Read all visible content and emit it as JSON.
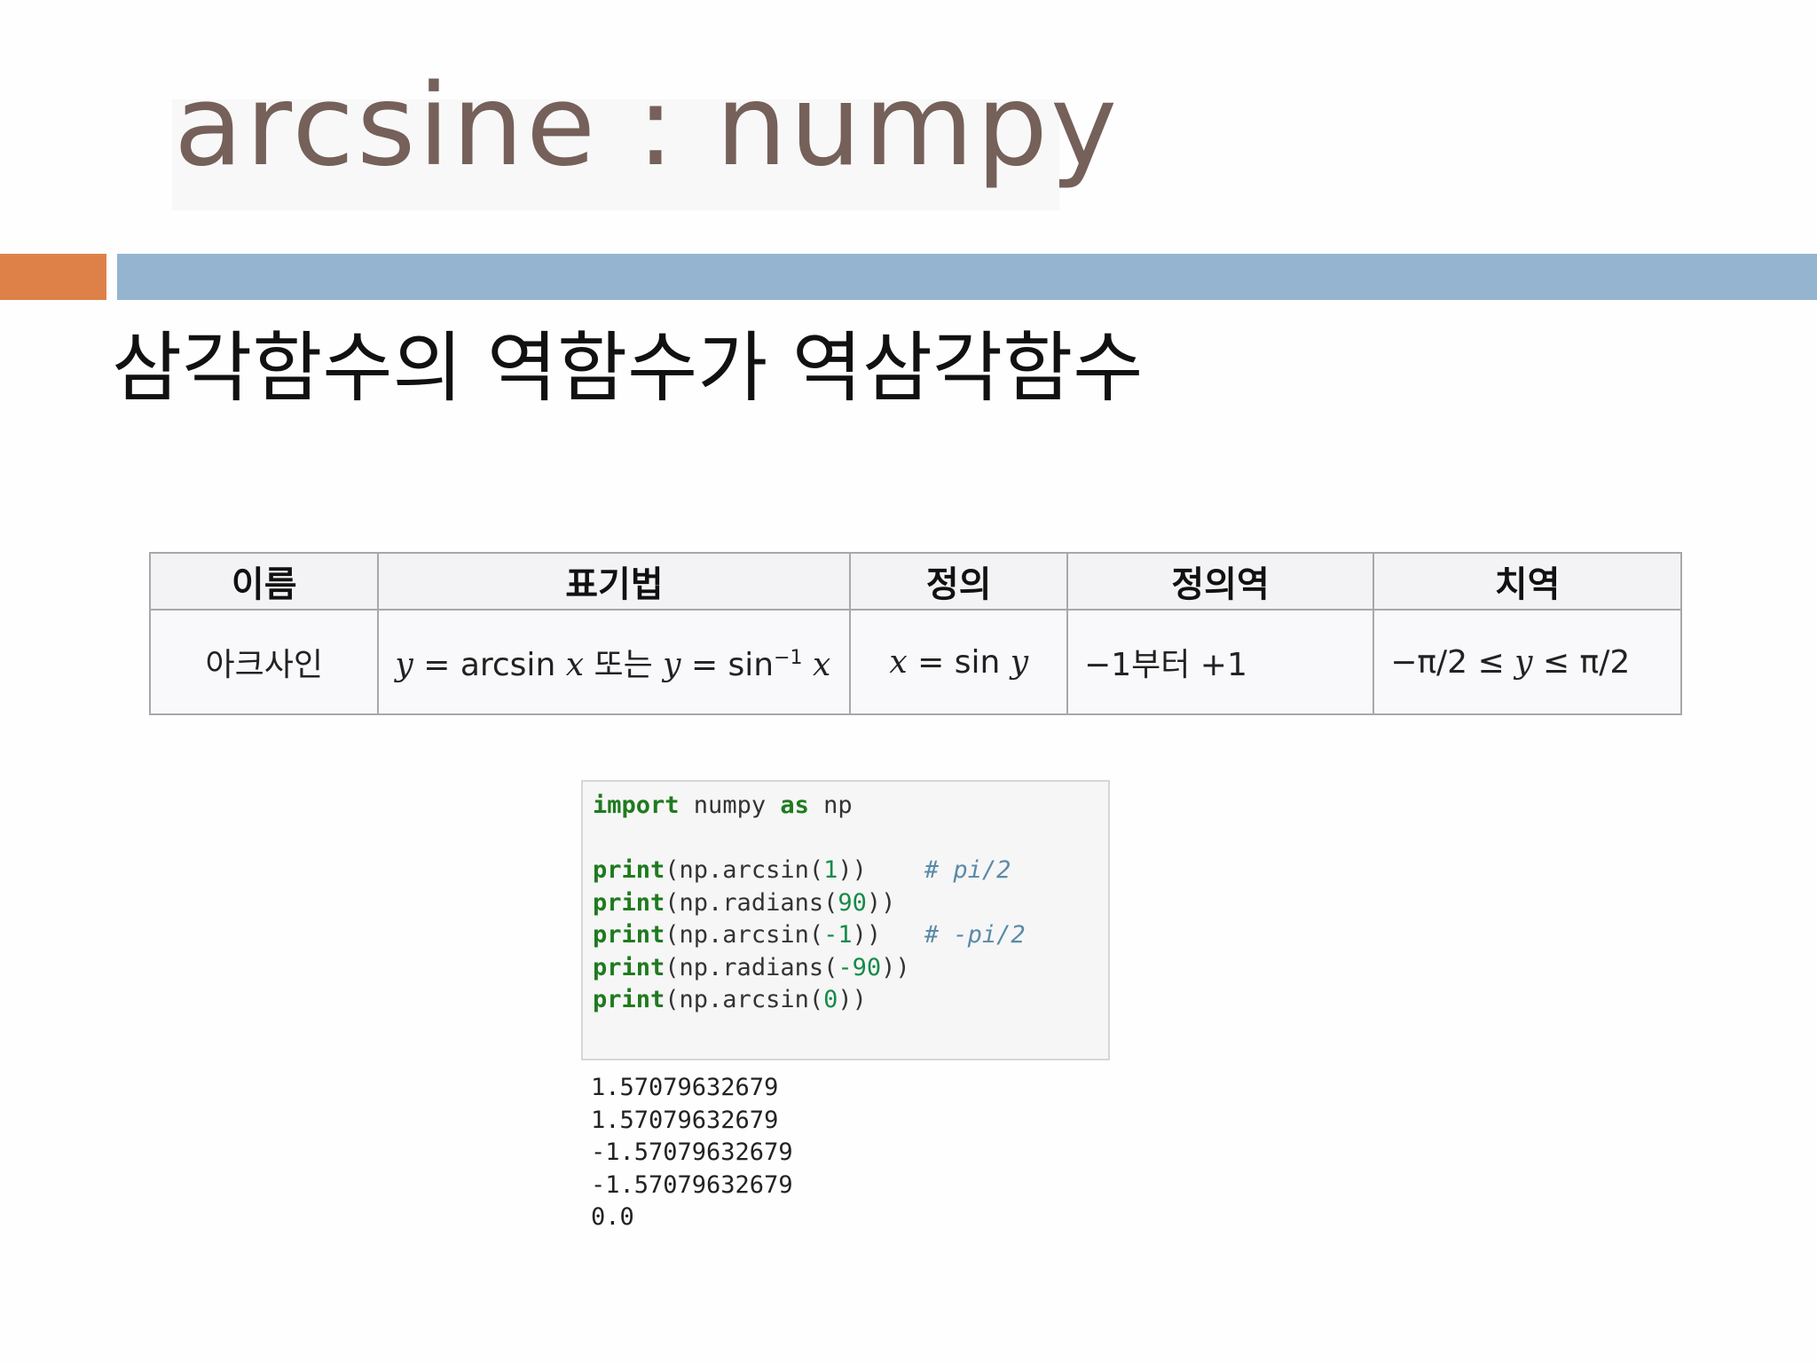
{
  "title": "arcsine : numpy",
  "subtitle": "삼각함수의 역함수가 역삼각함수",
  "colors": {
    "title": "#75605a",
    "accent_orange": "#dd8148",
    "accent_blue": "#94b4d0"
  },
  "table": {
    "headers": [
      "이름",
      "표기법",
      "정의",
      "정의역",
      "치역"
    ],
    "row": {
      "name": "아크사인",
      "notation": {
        "y1": "y",
        "eq1": " = arcsin ",
        "x1": "x",
        "or": " 또는 ",
        "y2": "y",
        "eq2": " = sin",
        "sup": "−1",
        "x2": "x"
      },
      "definition": {
        "x": "x",
        "eq": " = sin ",
        "y": "y"
      },
      "domain": "−1부터 +1",
      "range": {
        "left": "−π/2 ≤ ",
        "y": "y",
        "right": " ≤ π/2"
      }
    }
  },
  "code": {
    "import_kw": "import",
    "import_mod": " numpy ",
    "as_kw": "as",
    "import_alias": " np",
    "lines": [
      {
        "fn": "print",
        "pre": "(np.arcsin(",
        "num": "1",
        "post": "))",
        "comment": "    # pi/2"
      },
      {
        "fn": "print",
        "pre": "(np.radians(",
        "num": "90",
        "post": "))",
        "comment": ""
      },
      {
        "fn": "print",
        "pre": "(np.arcsin(",
        "num": "-1",
        "post": "))",
        "comment": "   # -pi/2"
      },
      {
        "fn": "print",
        "pre": "(np.radians(",
        "num": "-90",
        "post": "))",
        "comment": ""
      },
      {
        "fn": "print",
        "pre": "(np.arcsin(",
        "num": "0",
        "post": "))",
        "comment": ""
      }
    ]
  },
  "output": [
    "1.57079632679",
    "1.57079632679",
    "-1.57079632679",
    "-1.57079632679",
    "0.0"
  ]
}
